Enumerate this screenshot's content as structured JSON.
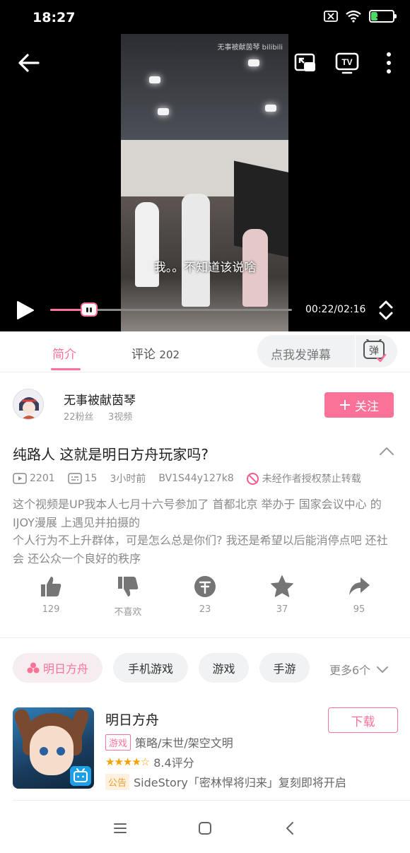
{
  "status_bar": {
    "time": "18:27",
    "battery": "33",
    "battery_level": 0.33
  },
  "video": {
    "watermark": "无事被献茵琴 bilibili",
    "subtitle": "我。。不知道该说啥",
    "time_display": "00:22/02:16",
    "progress": 0.16
  },
  "tabs": {
    "intro": "简介",
    "comments_label": "评论",
    "comments_count": "202",
    "danmaku_placeholder": "点我发弹幕",
    "danmaku_button_glyph": "弹"
  },
  "uploader": {
    "name": "无事被献茵琴",
    "fans": "22粉丝",
    "videos": "3视频",
    "follow_label": "关注"
  },
  "video_info": {
    "title": "纯路人 这就是明日方舟玩家吗?",
    "plays": "2201",
    "danmaku_count": "15",
    "time_ago": "3小时前",
    "bvid": "BV1S44y127k8",
    "no_repost": "未经作者授权禁止转载",
    "description": "这个视频是UP我本人七月十六号参加了 首都北京 举办于 国家会议中心 的IJOY漫展 上遇见并拍摄的\n个人行为不上升群体，可是怎么总是你们? 我还是希望以后能消停点吧 还社会 还公众一个良好的秩序"
  },
  "actions": {
    "like": "129",
    "dislike": "不喜欢",
    "coin": "23",
    "favorite": "37",
    "share": "95"
  },
  "tags": [
    "明日方舟",
    "手机游戏",
    "游戏",
    "手游"
  ],
  "more_tags": "更多6个",
  "game": {
    "name": "明日方舟",
    "download_label": "下载",
    "genre_badge": "游戏",
    "genres": "策略/末世/架空文明",
    "stars": "★★★★☆",
    "rating": "8.4评分",
    "notice_badge": "公告",
    "notice": "SideStory「密林悍将归来」复刻即将开启"
  },
  "colors": {
    "accent": "#fb7299",
    "star": "#f7a100",
    "notice": "#f19e2c"
  }
}
